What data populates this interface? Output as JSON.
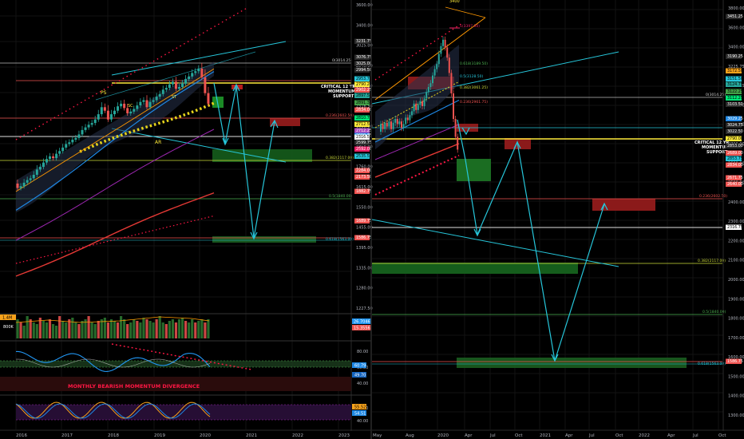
{
  "left_panel": {
    "price_axis_ticks": [
      "3600.00",
      "3400.00",
      "3025.00",
      "2845.00",
      "2689.00",
      "2316.50",
      "1930.00",
      "1850.00",
      "1760.00",
      "1615.00",
      "1550.00",
      "1455.00",
      "1395.00",
      "1335.00",
      "1280.00",
      "1227.50"
    ],
    "price_labels": [
      {
        "text": "3231.75",
        "color": "#2a2a2a"
      },
      {
        "text": "3076.75",
        "color": "#2a2a2a"
      },
      {
        "text": "3025.00",
        "color": "#2a2a2a"
      },
      {
        "text": "2994.50",
        "color": "#2a2a2a"
      },
      {
        "text": "2923.75",
        "color": "#f7a21b"
      },
      {
        "text": "2953.75",
        "color": "#26c6da"
      },
      {
        "text": "2790.25",
        "color": "#ffeb3b"
      },
      {
        "text": "2902.25",
        "color": "#ef5350"
      },
      {
        "text": "2897.50",
        "color": "#26a69a"
      },
      {
        "text": "2891.30",
        "color": "#43a047"
      },
      {
        "text": "2834.00",
        "color": "#ef5350"
      },
      {
        "text": "2810.75",
        "color": "#00e676"
      },
      {
        "text": "2712.50",
        "color": "#ffeb3b"
      },
      {
        "text": "2712.25",
        "color": "#ab47bc"
      },
      {
        "text": "2659.75",
        "color": "#1e88e5"
      },
      {
        "text": "2599.75",
        "color": "#2a2a2a"
      },
      {
        "text": "2592.00",
        "color": "#e91e63"
      },
      {
        "text": "2535.50",
        "color": "#26c6da"
      },
      {
        "text": "2316.50",
        "color": "#ffffff"
      },
      {
        "text": "2284.00",
        "color": "#ef5350"
      },
      {
        "text": "2173.50",
        "color": "#ef5350"
      },
      {
        "text": "1882.75",
        "color": "#ef5350"
      },
      {
        "text": "1689.75",
        "color": "#ef5350"
      },
      {
        "text": "1586.75",
        "color": "#ef5350"
      }
    ],
    "fib_labels": [
      "0(3014.25)",
      "0.236(2602.50)",
      "0.382(2117.00)",
      "0.5(1840.00)",
      "0.618(1563.00)"
    ],
    "annotations": {
      "ps": "PS",
      "sc": "SC",
      "ar": "AR",
      "st": "ST",
      "critical": [
        "CRITICAL 12 YR",
        "MOMENTUM",
        "SUPPORT"
      ],
      "divergence": "MONTHLY BEARISH MOMENTUM DIVERGENCE"
    },
    "volume": {
      "label": "800K",
      "badge": "1.4M",
      "value_labels": [
        {
          "text": "26.7046",
          "color": "#2196f3"
        },
        {
          "text": "15.3556",
          "color": "#ef5350"
        }
      ]
    },
    "rsi": {
      "ticks": [
        "80.00",
        "60.00",
        "40.00"
      ],
      "value_labels": [
        {
          "text": "60.79",
          "color": "#1e88e5"
        },
        {
          "text": "49.70",
          "color": "#1565c0"
        }
      ]
    },
    "stoch": {
      "ticks": [
        "60.00",
        "40.00"
      ],
      "value_labels": [
        {
          "text": "55.52",
          "color": "#f7a21b"
        },
        {
          "text": "54.51",
          "color": "#1e88e5"
        }
      ]
    },
    "time_axis": [
      "2016",
      "2017",
      "2018",
      "2019",
      "2020",
      "2021",
      "2022",
      "2023"
    ]
  },
  "right_panel": {
    "top_label": "3400",
    "price_axis_ticks": [
      "3800.00",
      "3600.00",
      "3400.00",
      "3225.75",
      "3093.75",
      "2950.00",
      "2850.00",
      "2700.00",
      "2600.00",
      "2500.00",
      "2400.00",
      "2300.00",
      "2200.00",
      "2100.00",
      "2000.00",
      "1900.00",
      "1800.00",
      "1700.00",
      "1600.00",
      "1500.00",
      "1400.00",
      "1300.00"
    ],
    "price_labels": [
      {
        "text": "3451.25",
        "color": "#2a2a2a"
      },
      {
        "text": "3190.25",
        "color": "#2a2a2a"
      },
      {
        "text": "3172.50",
        "color": "#f7a21b"
      },
      {
        "text": "3151.50",
        "color": "#26c6da"
      },
      {
        "text": "3124.75",
        "color": "#26a69a"
      },
      {
        "text": "3122.25",
        "color": "#43a047"
      },
      {
        "text": "3112.25",
        "color": "#00e676"
      },
      {
        "text": "3103.50",
        "color": "#2a2a2a"
      },
      {
        "text": "3029.25",
        "color": "#1e88e5"
      },
      {
        "text": "3024.75",
        "color": "#2a2a2a"
      },
      {
        "text": "3022.50",
        "color": "#2a2a2a"
      },
      {
        "text": "2790.00",
        "color": "#ffeb3b"
      },
      {
        "text": "2853.00",
        "color": "#2a2a2a"
      },
      {
        "text": "2689.00",
        "color": "#ef5350"
      },
      {
        "text": "2853.75",
        "color": "#26c6da"
      },
      {
        "text": "2834.00",
        "color": "#ef5350"
      },
      {
        "text": "2671.75",
        "color": "#ef5350"
      },
      {
        "text": "2640.00",
        "color": "#ef5350"
      },
      {
        "text": "2316.75",
        "color": "#ffffff"
      },
      {
        "text": "1586.75",
        "color": "#ef5350"
      }
    ],
    "fib_labels": [
      "1(3397.00)",
      "0.618(3189.50)",
      "0.5(3128.50)",
      "0.382(3061.25)",
      "0.236(2961.75)",
      "0(3014.25)",
      "0.236(2602.50)",
      "0.382(2117.00)",
      "0.5(1840.00)",
      "0.618(1563.00)"
    ],
    "annotations": {
      "critical": [
        "CRITICAL 12 YR",
        "MOMENTUM",
        "SUPPORT"
      ]
    },
    "time_axis": [
      "May",
      "Aug",
      "2020",
      "Apr",
      "Jul",
      "Oct",
      "2021",
      "Apr",
      "Jul",
      "Oct",
      "2022",
      "Apr",
      "Jul",
      "Oct"
    ]
  },
  "colors": {
    "background": "#000000",
    "grid": "#141414",
    "text": "#b2b5be",
    "bull": "#26a69a",
    "bear": "#ef5350",
    "cyan": "#26c6da",
    "yellow": "#ffeb3b",
    "green_zone": "#1b5e20",
    "red_zone": "#8b1a1a"
  }
}
